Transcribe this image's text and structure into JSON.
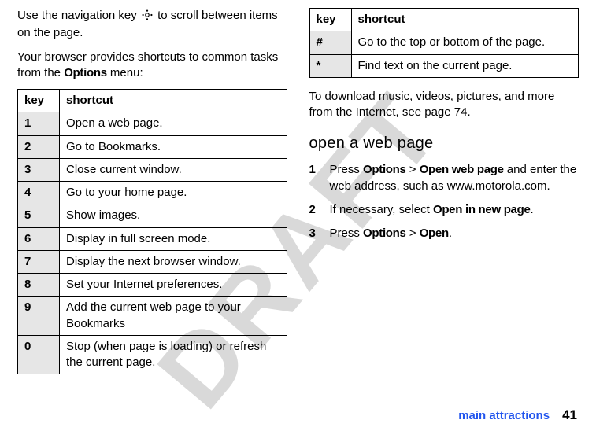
{
  "watermark": "DRAFT",
  "left": {
    "intro1_a": "Use the navigation key ",
    "intro1_b": " to scroll between items on the page.",
    "intro2_a": "Your browser provides shortcuts to common tasks from the ",
    "options_word": "Options",
    "intro2_b": " menu:",
    "headers": {
      "key": "key",
      "shortcut": "shortcut"
    },
    "rows": [
      {
        "key": "1",
        "text": "Open a web page."
      },
      {
        "key": "2",
        "text": "Go to Bookmarks."
      },
      {
        "key": "3",
        "text": "Close current window."
      },
      {
        "key": "4",
        "text": "Go to your home page."
      },
      {
        "key": "5",
        "text": "Show images."
      },
      {
        "key": "6",
        "text": "Display in full screen mode."
      },
      {
        "key": "7",
        "text": "Display the next browser window."
      },
      {
        "key": "8",
        "text": "Set your Internet preferences."
      },
      {
        "key": "9",
        "text": "Add the current web page to your Bookmarks"
      },
      {
        "key": "0",
        "text": "Stop (when page is loading) or refresh the current page."
      }
    ]
  },
  "right": {
    "headers": {
      "key": "key",
      "shortcut": "shortcut"
    },
    "rows": [
      {
        "key": "#",
        "text": "Go to the top or bottom of the page."
      },
      {
        "key": "*",
        "text": "Find text on the current page."
      }
    ],
    "download_text": "To download music, videos, pictures, and more from the Internet, see page 74.",
    "heading": "open a web page",
    "steps": {
      "s1_num": "1",
      "s1_a": "Press ",
      "s1_options": "Options",
      "s1_sep1": " > ",
      "s1_openweb": "Open web page",
      "s1_b": " and enter the web address, such as www.motorola.com.",
      "s2_num": "2",
      "s2_a": "If necessary, select ",
      "s2_opennew": "Open in new page",
      "s2_b": ".",
      "s3_num": "3",
      "s3_a": "Press ",
      "s3_options": "Options",
      "s3_sep": " > ",
      "s3_open": "Open",
      "s3_b": "."
    }
  },
  "footer": {
    "label": "main attractions",
    "page": "41"
  }
}
